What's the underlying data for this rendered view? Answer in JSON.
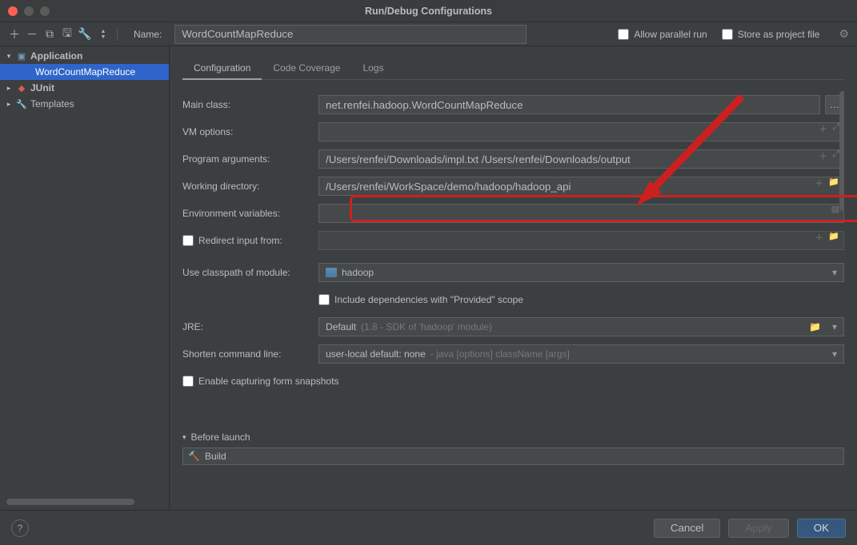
{
  "window": {
    "title": "Run/Debug Configurations"
  },
  "toolbar": {
    "name_label": "Name:",
    "name_value": "WordCountMapReduce",
    "allow_parallel": "Allow parallel run",
    "store_project": "Store as project file"
  },
  "sidebar": {
    "application": "Application",
    "child": "WordCountMapReduce",
    "junit": "JUnit",
    "templates": "Templates"
  },
  "tabs": {
    "configuration": "Configuration",
    "coverage": "Code Coverage",
    "logs": "Logs"
  },
  "form": {
    "main_class": {
      "label": "Main class:",
      "value": "net.renfei.hadoop.WordCountMapReduce"
    },
    "vm_options": {
      "label": "VM options:",
      "value": ""
    },
    "program_args": {
      "label": "Program arguments:",
      "value": "/Users/renfei/Downloads/impl.txt /Users/renfei/Downloads/output"
    },
    "working_dir": {
      "label": "Working directory:",
      "value": "/Users/renfei/WorkSpace/demo/hadoop/hadoop_api"
    },
    "env_vars": {
      "label": "Environment variables:",
      "value": ""
    },
    "redirect": {
      "label": "Redirect input from:",
      "value": ""
    },
    "classpath": {
      "label": "Use classpath of module:",
      "value": "hadoop"
    },
    "include_provided": "Include dependencies with \"Provided\" scope",
    "jre": {
      "label": "JRE:",
      "value": "Default",
      "hint": "(1.8 - SDK of 'hadoop' module)"
    },
    "shorten": {
      "label": "Shorten command line:",
      "value": "user-local default: none",
      "hint": "- java [options] className [args]"
    },
    "snapshots": "Enable capturing form snapshots"
  },
  "before_launch": {
    "header": "Before launch",
    "build": "Build"
  },
  "buttons": {
    "cancel": "Cancel",
    "apply": "Apply",
    "ok": "OK"
  }
}
